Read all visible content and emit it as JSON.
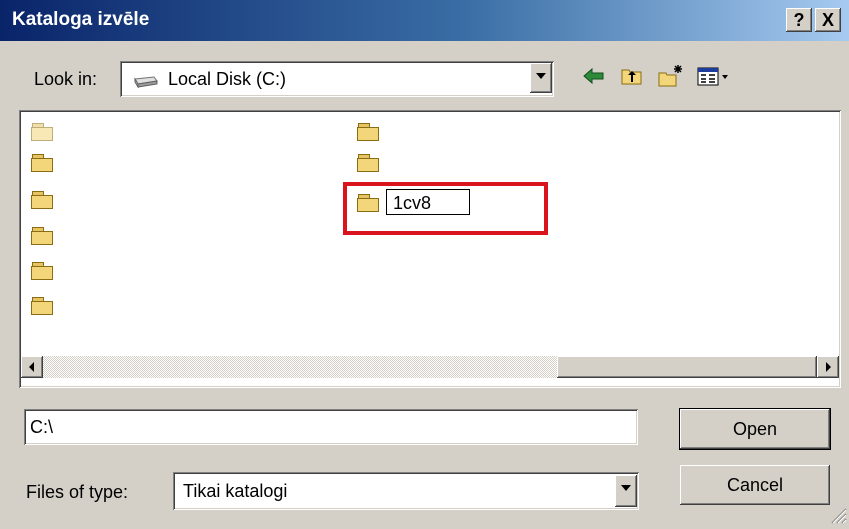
{
  "dialog": {
    "title": "Kataloga izvēle",
    "help_button": "?",
    "close_button": "X"
  },
  "lookin": {
    "label": "Look in:",
    "value": "Local Disk (C:)",
    "icons": [
      "back-arrow-icon",
      "up-folder-icon",
      "new-folder-icon",
      "view-menu-icon"
    ]
  },
  "filelist": {
    "rename_value": "1cv8",
    "folders_col1": [
      "",
      "",
      "",
      "",
      "",
      ""
    ],
    "folders_col2": [
      "",
      ""
    ]
  },
  "filename": {
    "value": "C:\\"
  },
  "filetype": {
    "label": "Files of type:",
    "value": "Tikai katalogi"
  },
  "buttons": {
    "open": "Open",
    "cancel": "Cancel"
  },
  "colors": {
    "titlebar_start": "#0a246a",
    "titlebar_end": "#a6caf0",
    "highlight": "#d9141c",
    "face": "#d4d0c8"
  }
}
